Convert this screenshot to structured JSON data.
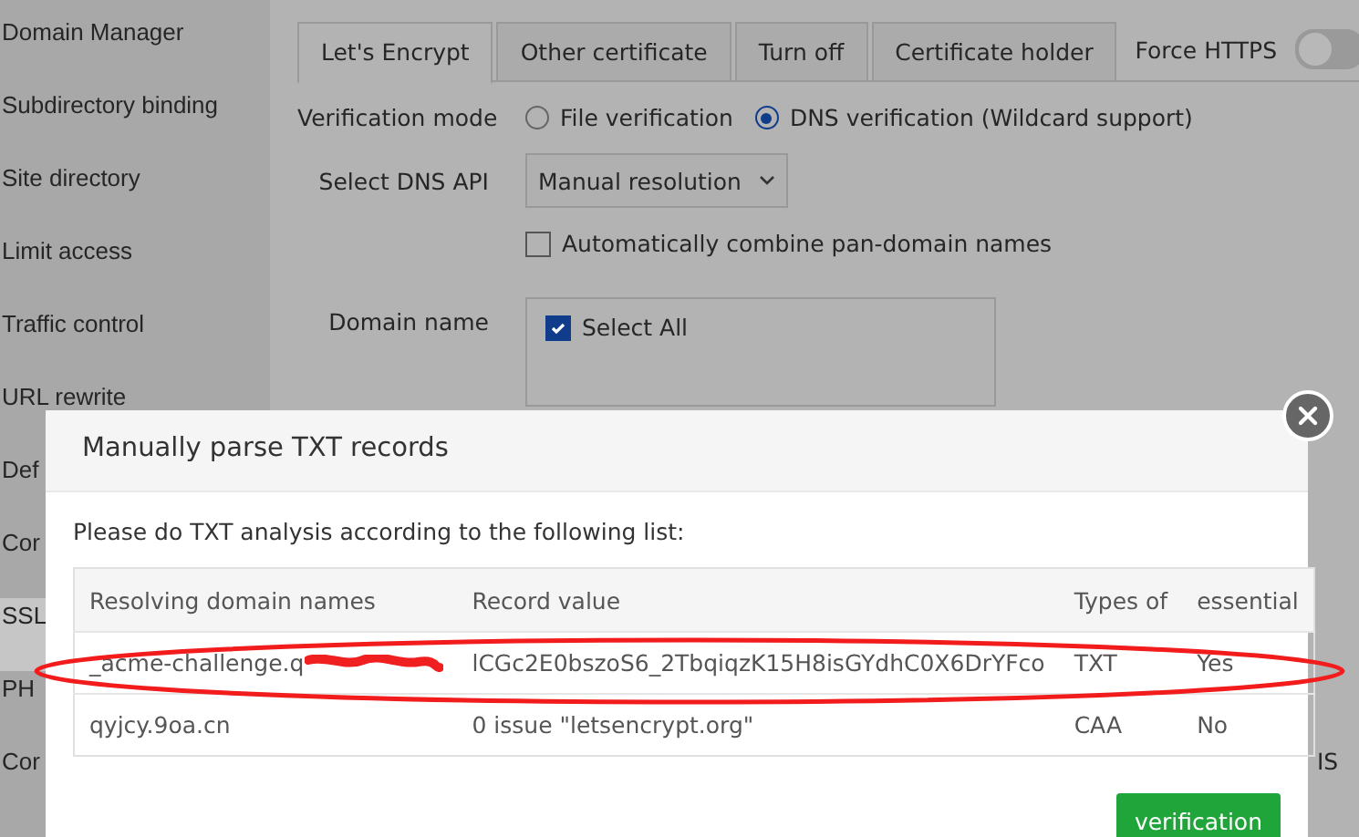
{
  "sidebar": {
    "items": [
      {
        "label": "Domain Manager",
        "selected": false
      },
      {
        "label": "Subdirectory binding",
        "selected": false
      },
      {
        "label": "Site directory",
        "selected": false
      },
      {
        "label": "Limit access",
        "selected": false
      },
      {
        "label": "Traffic control",
        "selected": false
      },
      {
        "label": "URL rewrite",
        "selected": false
      },
      {
        "label": "Def",
        "selected": false
      },
      {
        "label": "Cor",
        "selected": false
      },
      {
        "label": "SSL",
        "selected": true
      },
      {
        "label": "PH",
        "selected": false
      },
      {
        "label": "Cor",
        "selected": false
      }
    ]
  },
  "tabs": [
    {
      "label": "Let's Encrypt",
      "selected": true
    },
    {
      "label": "Other certificate",
      "selected": false
    },
    {
      "label": "Turn off",
      "selected": false
    },
    {
      "label": "Certificate holder",
      "selected": false
    }
  ],
  "force_https": {
    "label": "Force HTTPS",
    "on": false
  },
  "form": {
    "verification_mode": {
      "label": "Verification mode",
      "options": [
        {
          "label": "File verification",
          "selected": false
        },
        {
          "label": "DNS verification (Wildcard support)",
          "selected": true
        }
      ]
    },
    "dns_api": {
      "label": "Select DNS API",
      "value": "Manual resolution"
    },
    "combine": {
      "label": "Automatically combine pan-domain names",
      "checked": false
    },
    "domain": {
      "label": "Domain name",
      "select_all": {
        "label": "Select All",
        "checked": true
      }
    }
  },
  "background_text": "IS",
  "dialog": {
    "title": "Manually parse TXT records",
    "intro": "Please do TXT analysis according to the following list:",
    "table": {
      "columns": [
        "Resolving domain names",
        "Record value",
        "Types of",
        "essential"
      ],
      "rows": [
        {
          "cells": [
            "_acme-challenge.q",
            "lCGc2E0bszoS6_2TbqiqzK15H8isGYdhC0X6DrYFco",
            "TXT",
            "Yes"
          ],
          "redacted": true,
          "circled": true
        },
        {
          "cells": [
            "qyjcy.9oa.cn",
            "0 issue \"letsencrypt.org\"",
            "CAA",
            "No"
          ],
          "redacted": false,
          "circled": false
        }
      ]
    },
    "button": "verification"
  }
}
